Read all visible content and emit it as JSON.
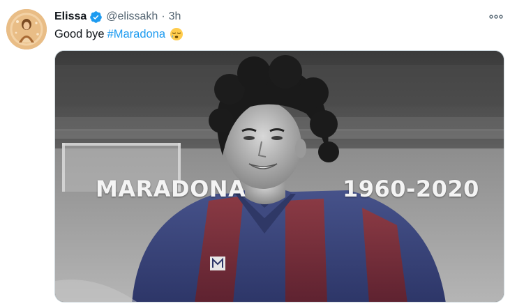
{
  "tweet": {
    "author_name": "Elissa",
    "handle": "@elissakh",
    "separator": "·",
    "time": "3h",
    "text": "Good bye",
    "hashtag": "#Maradona",
    "emoji": "sleepy-face-emoji"
  },
  "media": {
    "overlay_name": "MARADONA",
    "overlay_years": "1960-2020"
  },
  "icons": {
    "verified": "verified-badge-icon",
    "more": "more-options-icon"
  },
  "colors": {
    "verified_blue": "#1d9bf0",
    "hashtag_blue": "#1d9bf0",
    "text": "#0f1419",
    "secondary": "#536471"
  }
}
